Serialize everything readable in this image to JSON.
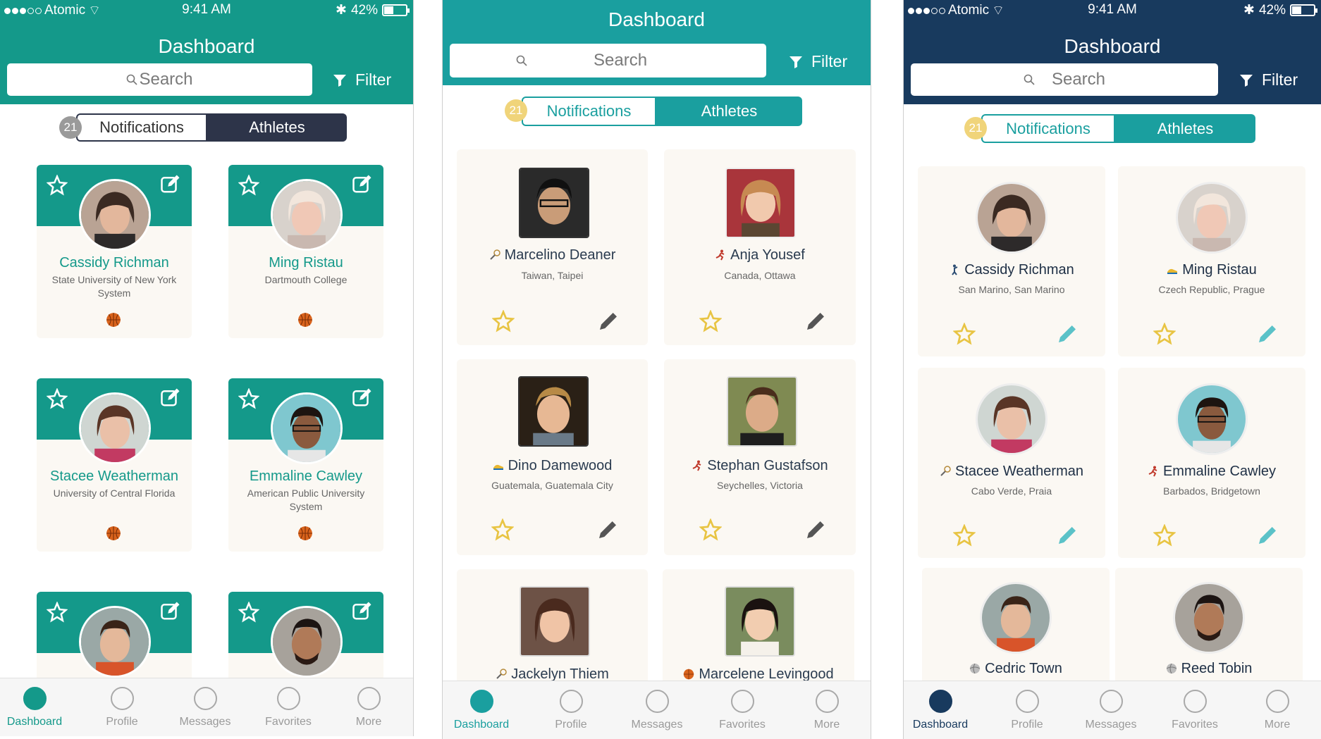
{
  "phone1": {
    "status": {
      "carrier": "Atomic",
      "time": "9:41 AM",
      "battery": "42%"
    },
    "title": "Dashboard",
    "search_placeholder": "Search",
    "filter_label": "Filter",
    "badge": "21",
    "segments": [
      "Notifications",
      "Athletes"
    ],
    "cards": [
      {
        "name": "Cassidy Richman",
        "sub1": "State University of New York",
        "sub2": "System"
      },
      {
        "name": "Ming Ristau",
        "sub1": "Dartmouth College",
        "sub2": ""
      },
      {
        "name": "Stacee Weatherman",
        "sub1": "University of Central Florida",
        "sub2": ""
      },
      {
        "name": "Emmaline Cawley",
        "sub1": "American Public University",
        "sub2": "System"
      }
    ],
    "tabs": [
      "Dashboard",
      "Profile",
      "Messages",
      "Favorites",
      "More"
    ]
  },
  "phone2": {
    "title": "Dashboard",
    "search_placeholder": "Search",
    "filter_label": "Filter",
    "badge": "21",
    "segments": [
      "Notifications",
      "Athletes"
    ],
    "cards": [
      {
        "name": "Marcelino Deaner",
        "location": "Taiwan, Taipei"
      },
      {
        "name": "Anja Yousef",
        "location": "Canada, Ottawa"
      },
      {
        "name": "Dino Damewood",
        "location": "Guatemala, Guatemala City"
      },
      {
        "name": "Stephan Gustafson",
        "location": "Seychelles, Victoria"
      },
      {
        "name": "Jackelyn Thiem",
        "location": ""
      },
      {
        "name": "Marcelene Levingood",
        "location": ""
      }
    ],
    "tabs": [
      "Dashboard",
      "Profile",
      "Messages",
      "Favorites",
      "More"
    ]
  },
  "phone3": {
    "status": {
      "carrier": "Atomic",
      "time": "9:41 AM",
      "battery": "42%"
    },
    "title": "Dashboard",
    "search_placeholder": "Search",
    "filter_label": "Filter",
    "badge": "21",
    "segments": [
      "Notifications",
      "Athletes"
    ],
    "cards": [
      {
        "name": "Cassidy Richman",
        "location": "San Marino, San Marino"
      },
      {
        "name": "Ming Ristau",
        "location": "Czech Republic, Prague"
      },
      {
        "name": "Stacee Weatherman",
        "location": "Cabo Verde, Praia"
      },
      {
        "name": "Emmaline Cawley",
        "location": "Barbados, Bridgetown"
      },
      {
        "name": "Cedric Town",
        "location": ""
      },
      {
        "name": "Reed Tobin",
        "location": ""
      }
    ],
    "tabs": [
      "Dashboard",
      "Profile",
      "Messages",
      "Favorites",
      "More"
    ]
  },
  "colors": {
    "teal": "#14998a",
    "teal2": "#1a9f9f",
    "navy": "#183a5e",
    "dark_seg": "#2d3449",
    "star": "#e8c443",
    "badge": "#f0d47a"
  }
}
